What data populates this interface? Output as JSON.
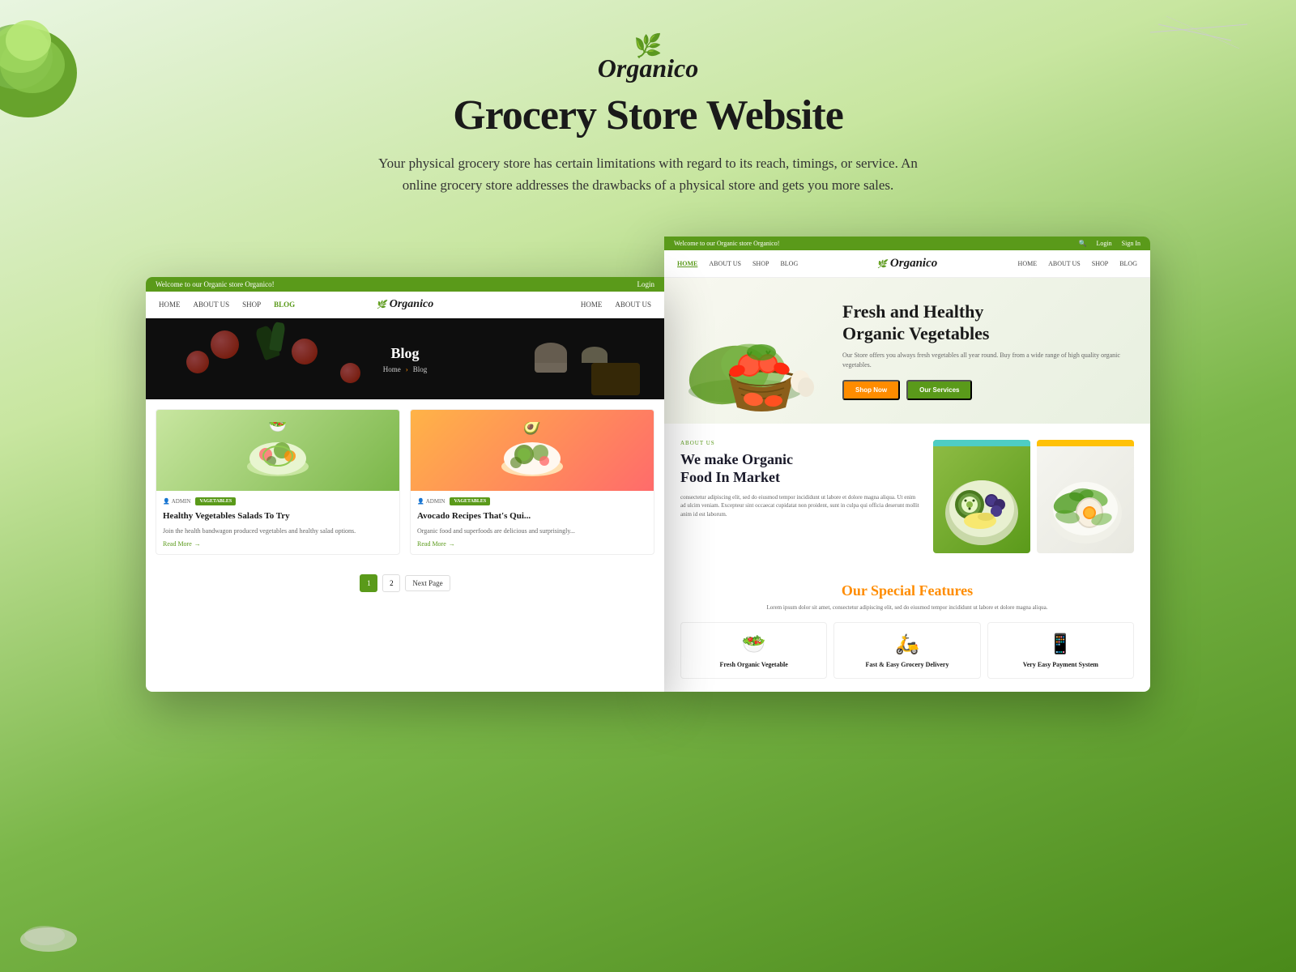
{
  "header": {
    "brand": "Organico",
    "leaf": "🌿",
    "title": "Grocery Store Website",
    "subtitle": "Your physical grocery store has certain limitations with regard to its reach, timings, or service. An online grocery store addresses the drawbacks of a physical store and gets you more sales."
  },
  "left_screenshot": {
    "top_bar": "Welcome to our Organic store Organico!",
    "top_bar_right": "Login",
    "nav": {
      "links": [
        "HOME",
        "ABOUT US",
        "SHOP",
        "BLOG"
      ],
      "brand": "Organico",
      "right_links": [
        "HOME",
        "ABOUT US"
      ]
    },
    "hero": {
      "title": "Blog",
      "breadcrumb_home": "Home",
      "breadcrumb_current": "Blog"
    },
    "blog_cards": [
      {
        "meta_author": "ADMIN",
        "meta_tag": "VAGETABLES",
        "title": "Healthy Vegetables Salads To Try",
        "desc": "Join the health bandwagon produced vegetables and healthy salad options.",
        "read_more": "Read More"
      },
      {
        "meta_author": "ADMIN",
        "meta_tag": "VAGETABLES",
        "title": "Avocado Recipes That's Qui...",
        "desc": "Organic food and superfoods are delicious and surprisingly...",
        "read_more": "Read More"
      }
    ],
    "pagination": {
      "page1": "1",
      "page2": "2",
      "next": "Next Page"
    }
  },
  "right_screenshot": {
    "top_bar": "Welcome to our Organic store Organico!",
    "top_bar_right_login": "Login",
    "top_bar_right_signin": "Sign In",
    "nav": {
      "links": [
        "HOME",
        "ABOUT US",
        "SHOP",
        "BLOG"
      ],
      "brand": "Organico",
      "right_links": [
        "HOME",
        "ABOUT US",
        "SHOP",
        "BLOG"
      ]
    },
    "hero": {
      "heading_line1": "Fresh and Healthy",
      "heading_line2": "Organic Vegetables",
      "desc": "Our Store offers you always fresh vegetables all year round. Buy from a wide range of high quality organic vegetables.",
      "btn_shop": "Shop Now",
      "btn_services": "Our Services"
    },
    "about": {
      "tag": "ABOUT US",
      "heading_line1": "We make Organic",
      "heading_line2": "Food In Market",
      "desc": "consectetur adipiscing elit, sed do eiusmod tempor incididunt ut labore et dolore magna aliqua. Ut enim ad ulcim veniam. Excepteur sint occaecat cupidatat non proident, sunt in culpa qui officia deserunt mollit anim id est laborum."
    },
    "features": {
      "title_black": "Our Special",
      "title_orange": " Features",
      "subtitle": "Lorem ipsum dolor sit amet, consectetur adipiscing elit, sed do eiusmod tempor incididunt ut labore et dolore magna aliqua.",
      "cards": [
        {
          "icon": "🥗",
          "title": "Fresh Organic Vegetable"
        },
        {
          "icon": "🛵",
          "title": "Fast & Easy Grocery Delivery"
        },
        {
          "icon": "📱",
          "title": "Very Easy Payment System"
        }
      ]
    }
  }
}
